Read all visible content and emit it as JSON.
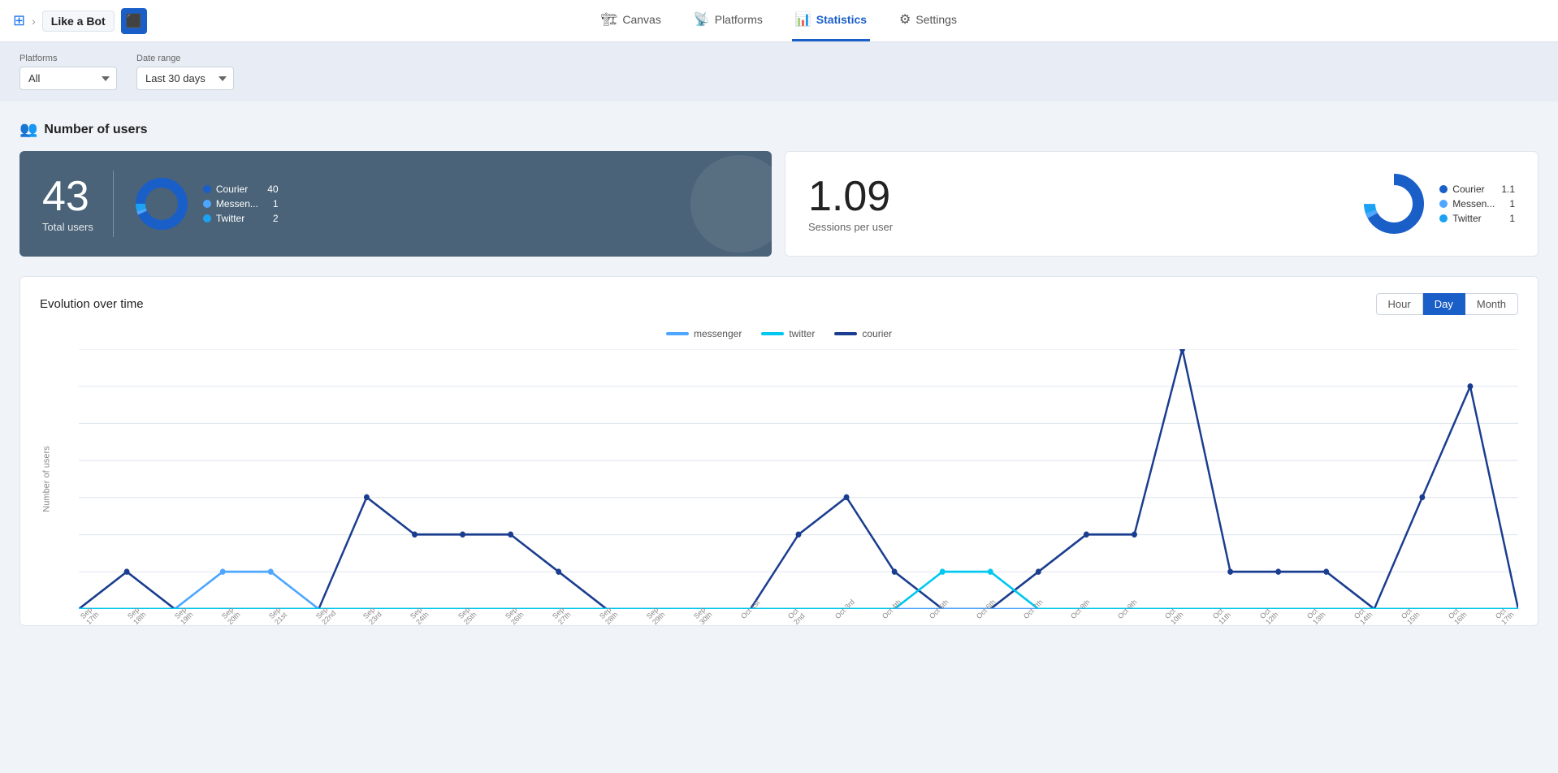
{
  "nav": {
    "bot_name": "Like a Bot",
    "items": [
      {
        "id": "canvas",
        "label": "Canvas",
        "icon": "🏗",
        "active": false
      },
      {
        "id": "platforms",
        "label": "Platforms",
        "icon": "📡",
        "active": false
      },
      {
        "id": "statistics",
        "label": "Statistics",
        "icon": "📊",
        "active": true
      },
      {
        "id": "settings",
        "label": "Settings",
        "icon": "⚙",
        "active": false
      }
    ]
  },
  "filters": {
    "platforms_label": "Platforms",
    "platforms_value": "All",
    "date_range_label": "Date range",
    "date_range_value": "Last 30 days"
  },
  "section": {
    "title": "Number of users"
  },
  "users_card": {
    "total": "43",
    "label": "Total users",
    "platforms": [
      {
        "name": "Courier",
        "color": "#1a5fc8",
        "value": "40"
      },
      {
        "name": "Messen...",
        "color": "#4da6ff",
        "value": "1"
      },
      {
        "name": "Twitter",
        "color": "#1da1f2",
        "value": "2"
      }
    ]
  },
  "sessions_card": {
    "value": "1.09",
    "label": "Sessions per user",
    "platforms": [
      {
        "name": "Courier",
        "color": "#1a5fc8",
        "value": "1.1"
      },
      {
        "name": "Messen...",
        "color": "#4da6ff",
        "value": "1"
      },
      {
        "name": "Twitter",
        "color": "#1da1f2",
        "value": "1"
      }
    ]
  },
  "chart": {
    "title": "Evolution over time",
    "y_label": "Number of users",
    "controls": [
      "Hour",
      "Day",
      "Month"
    ],
    "active_control": "Day",
    "legend": [
      {
        "label": "messenger",
        "color": "#4da6ff"
      },
      {
        "label": "twitter",
        "color": "#00c8f0"
      },
      {
        "label": "courier",
        "color": "#1a3d8f"
      }
    ],
    "x_labels": [
      "Sep 17th",
      "Sep 18th",
      "Sep 19th",
      "Sep 20th",
      "Sep 21st",
      "Sep 22nd",
      "Sep 23rd",
      "Sep 24th",
      "Sep 25th",
      "Sep 26th",
      "Sep 27th",
      "Sep 28th",
      "Sep 29th",
      "Sep 30th",
      "Oct 1st",
      "Oct 2nd",
      "Oct 3rd",
      "Oct 4th",
      "Oct 5th",
      "Oct 6th",
      "Oct 7th",
      "Oct 8th",
      "Oct 9th",
      "Oct 10th",
      "Oct 11th",
      "Oct 12th",
      "Oct 13th",
      "Oct 14th",
      "Oct 15th",
      "Oct 16th",
      "Oct 17th"
    ],
    "y_max": 7,
    "courier_data": [
      0,
      1,
      0,
      0,
      0,
      0,
      3,
      2,
      2,
      2,
      1,
      0,
      0,
      0,
      0,
      2,
      3,
      1,
      0,
      0,
      1,
      2,
      2,
      7,
      1,
      1,
      1,
      0,
      3,
      6,
      0
    ],
    "messenger_data": [
      0,
      0,
      0,
      1,
      1,
      0,
      0,
      0,
      0,
      0,
      0,
      0,
      0,
      0,
      0,
      0,
      0,
      0,
      0,
      0,
      0,
      0,
      0,
      0,
      0,
      0,
      0,
      0,
      0,
      0,
      0
    ],
    "twitter_data": [
      0,
      0,
      0,
      0,
      0,
      0,
      0,
      0,
      0,
      0,
      0,
      0,
      0,
      0,
      0,
      0,
      0,
      0,
      1,
      1,
      0,
      0,
      0,
      0,
      0,
      0,
      0,
      0,
      0,
      0,
      0
    ]
  }
}
